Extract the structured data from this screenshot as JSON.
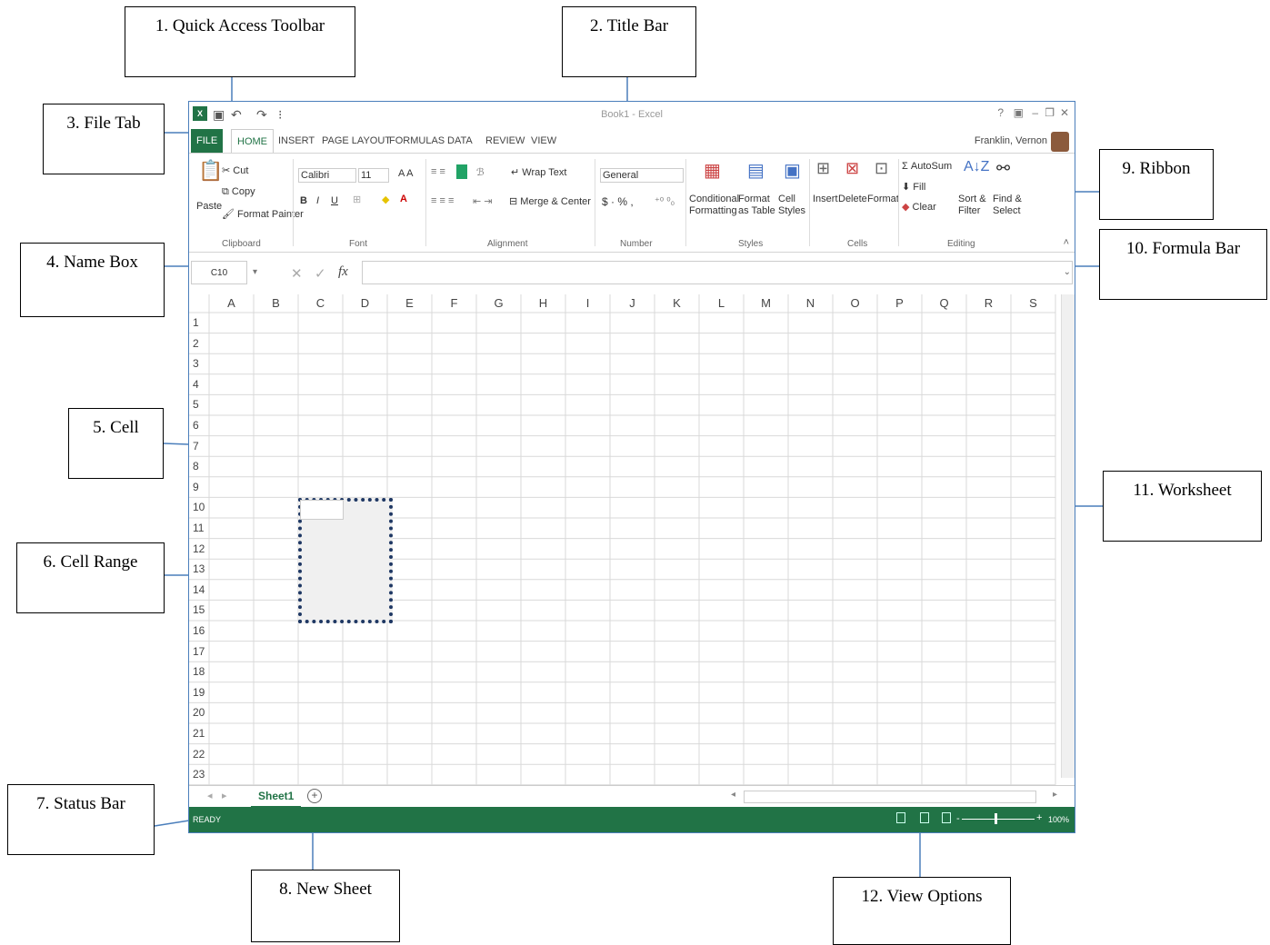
{
  "callouts": {
    "quick_access_toolbar": "1. Quick Access Toolbar",
    "title_bar": "2. Title Bar",
    "file_tab": "3. File Tab",
    "name_box": "4. Name Box",
    "cell": "5. Cell",
    "cell_range": "6. Cell Range",
    "status_bar": "7. Status Bar",
    "new_sheet": "8. New Sheet",
    "ribbon": "9. Ribbon",
    "formula_bar": "10. Formula Bar",
    "worksheet": "11. Worksheet",
    "view_options": "12. View Options"
  },
  "excel": {
    "title": "Book1 - Excel",
    "user": "Franklin, Vernon",
    "tabs": [
      "FILE",
      "HOME",
      "INSERT",
      "PAGE LAYOUT",
      "FORMULAS",
      "DATA",
      "REVIEW",
      "VIEW"
    ],
    "ribbon": {
      "clipboard": {
        "paste": "Paste",
        "cut": "Cut",
        "copy": "Copy",
        "format_painter": "Format Painter",
        "group": "Clipboard"
      },
      "font": {
        "name": "Calibri",
        "size": "11",
        "group": "Font"
      },
      "alignment": {
        "wrap": "Wrap Text",
        "merge": "Merge & Center",
        "group": "Alignment"
      },
      "number": {
        "format": "General",
        "group": "Number"
      },
      "styles": {
        "conditional": "Conditional Formatting",
        "format_as_table": "Format as Table",
        "cell_styles": "Cell Styles",
        "group": "Styles"
      },
      "cells": {
        "insert": "Insert",
        "delete": "Delete",
        "format": "Format",
        "group": "Cells"
      },
      "editing": {
        "autosum": "AutoSum",
        "fill": "Fill",
        "clear": "Clear",
        "sort": "Sort & Filter",
        "find": "Find & Select",
        "group": "Editing"
      }
    },
    "name_box": "C10",
    "fx": "fx",
    "columns": [
      "A",
      "B",
      "C",
      "D",
      "E",
      "F",
      "G",
      "H",
      "I",
      "J",
      "K",
      "L",
      "M",
      "N",
      "O",
      "P",
      "Q",
      "R",
      "S"
    ],
    "rows": [
      "1",
      "2",
      "3",
      "4",
      "5",
      "6",
      "7",
      "8",
      "9",
      "10",
      "11",
      "12",
      "13",
      "14",
      "15",
      "16",
      "17",
      "18",
      "19",
      "20",
      "21",
      "22",
      "23"
    ],
    "sheet": "Sheet1",
    "new_sheet_symbol": "+",
    "status": "READY",
    "zoom": "100%"
  }
}
